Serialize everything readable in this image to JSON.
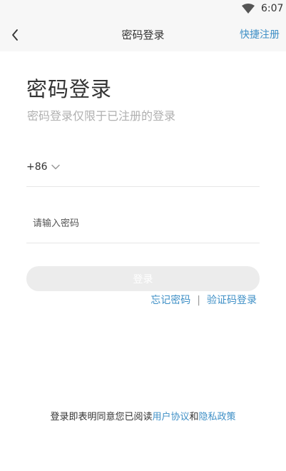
{
  "status_bar": {
    "time": "6:07",
    "wifi_icon": "wifi-icon"
  },
  "nav": {
    "back_icon": "chevron-left-icon",
    "title": "密码登录",
    "right_action": "快捷注册"
  },
  "heading": {
    "title": "密码登录",
    "subtitle": "密码登录仅限于已注册的登录"
  },
  "phone": {
    "country_code": "+86",
    "dropdown_icon": "chevron-down-icon",
    "value": "",
    "placeholder": ""
  },
  "password": {
    "value": "",
    "placeholder": "请输入密码"
  },
  "login_button": {
    "label": "登录"
  },
  "links": {
    "forgot_password": "忘记密码",
    "separator": "|",
    "sms_login": "验证码登录"
  },
  "agreement": {
    "prefix": "登录即表明同意您已阅读",
    "user_agreement": "用户协议",
    "conjunction": "和",
    "privacy_policy": "隐私政策"
  },
  "colors": {
    "accent": "#3e8fc6",
    "disabled_button": "#ececec",
    "subtitle": "#b0b0b0",
    "bar_background": "#f7f7f7"
  }
}
